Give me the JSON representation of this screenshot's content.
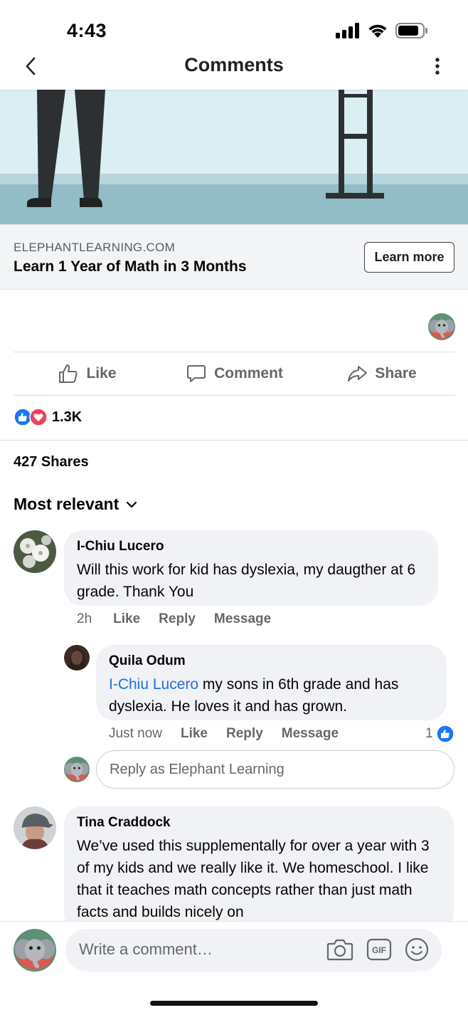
{
  "status": {
    "time": "4:43"
  },
  "nav": {
    "title": "Comments"
  },
  "ad": {
    "domain": "ELEPHANTLEARNING.COM",
    "headline": "Learn 1 Year of Math in 3 Months",
    "cta": "Learn more"
  },
  "actions": {
    "like": "Like",
    "comment": "Comment",
    "share": "Share"
  },
  "reactions": {
    "count": "1.3K"
  },
  "shares": "427 Shares",
  "sort": {
    "label": "Most relevant"
  },
  "comments": [
    {
      "name": "I-Chiu Lucero",
      "text": "Will this work for kid has dyslexia, my daugther at 6 grade. Thank You",
      "time": "2h",
      "like": "Like",
      "reply": "Reply",
      "message": "Message"
    },
    {
      "name": "Quila Odum",
      "mention": "I-Chiu Lucero",
      "text": " my sons in 6th grade and has dyslexia. He loves it and has grown.",
      "time": "Just now",
      "like": "Like",
      "reply": "Reply",
      "message": "Message",
      "like_count": "1"
    },
    {
      "name": "Tina Craddock",
      "text": "We’ve used this supplementally for over a year with 3 of my kids and we really like it. We homeschool. I like that it teaches  math concepts rather than just math facts and builds nicely on"
    }
  ],
  "reply_placeholder": "Reply as Elephant Learning",
  "composer": {
    "placeholder": "Write a comment…"
  }
}
